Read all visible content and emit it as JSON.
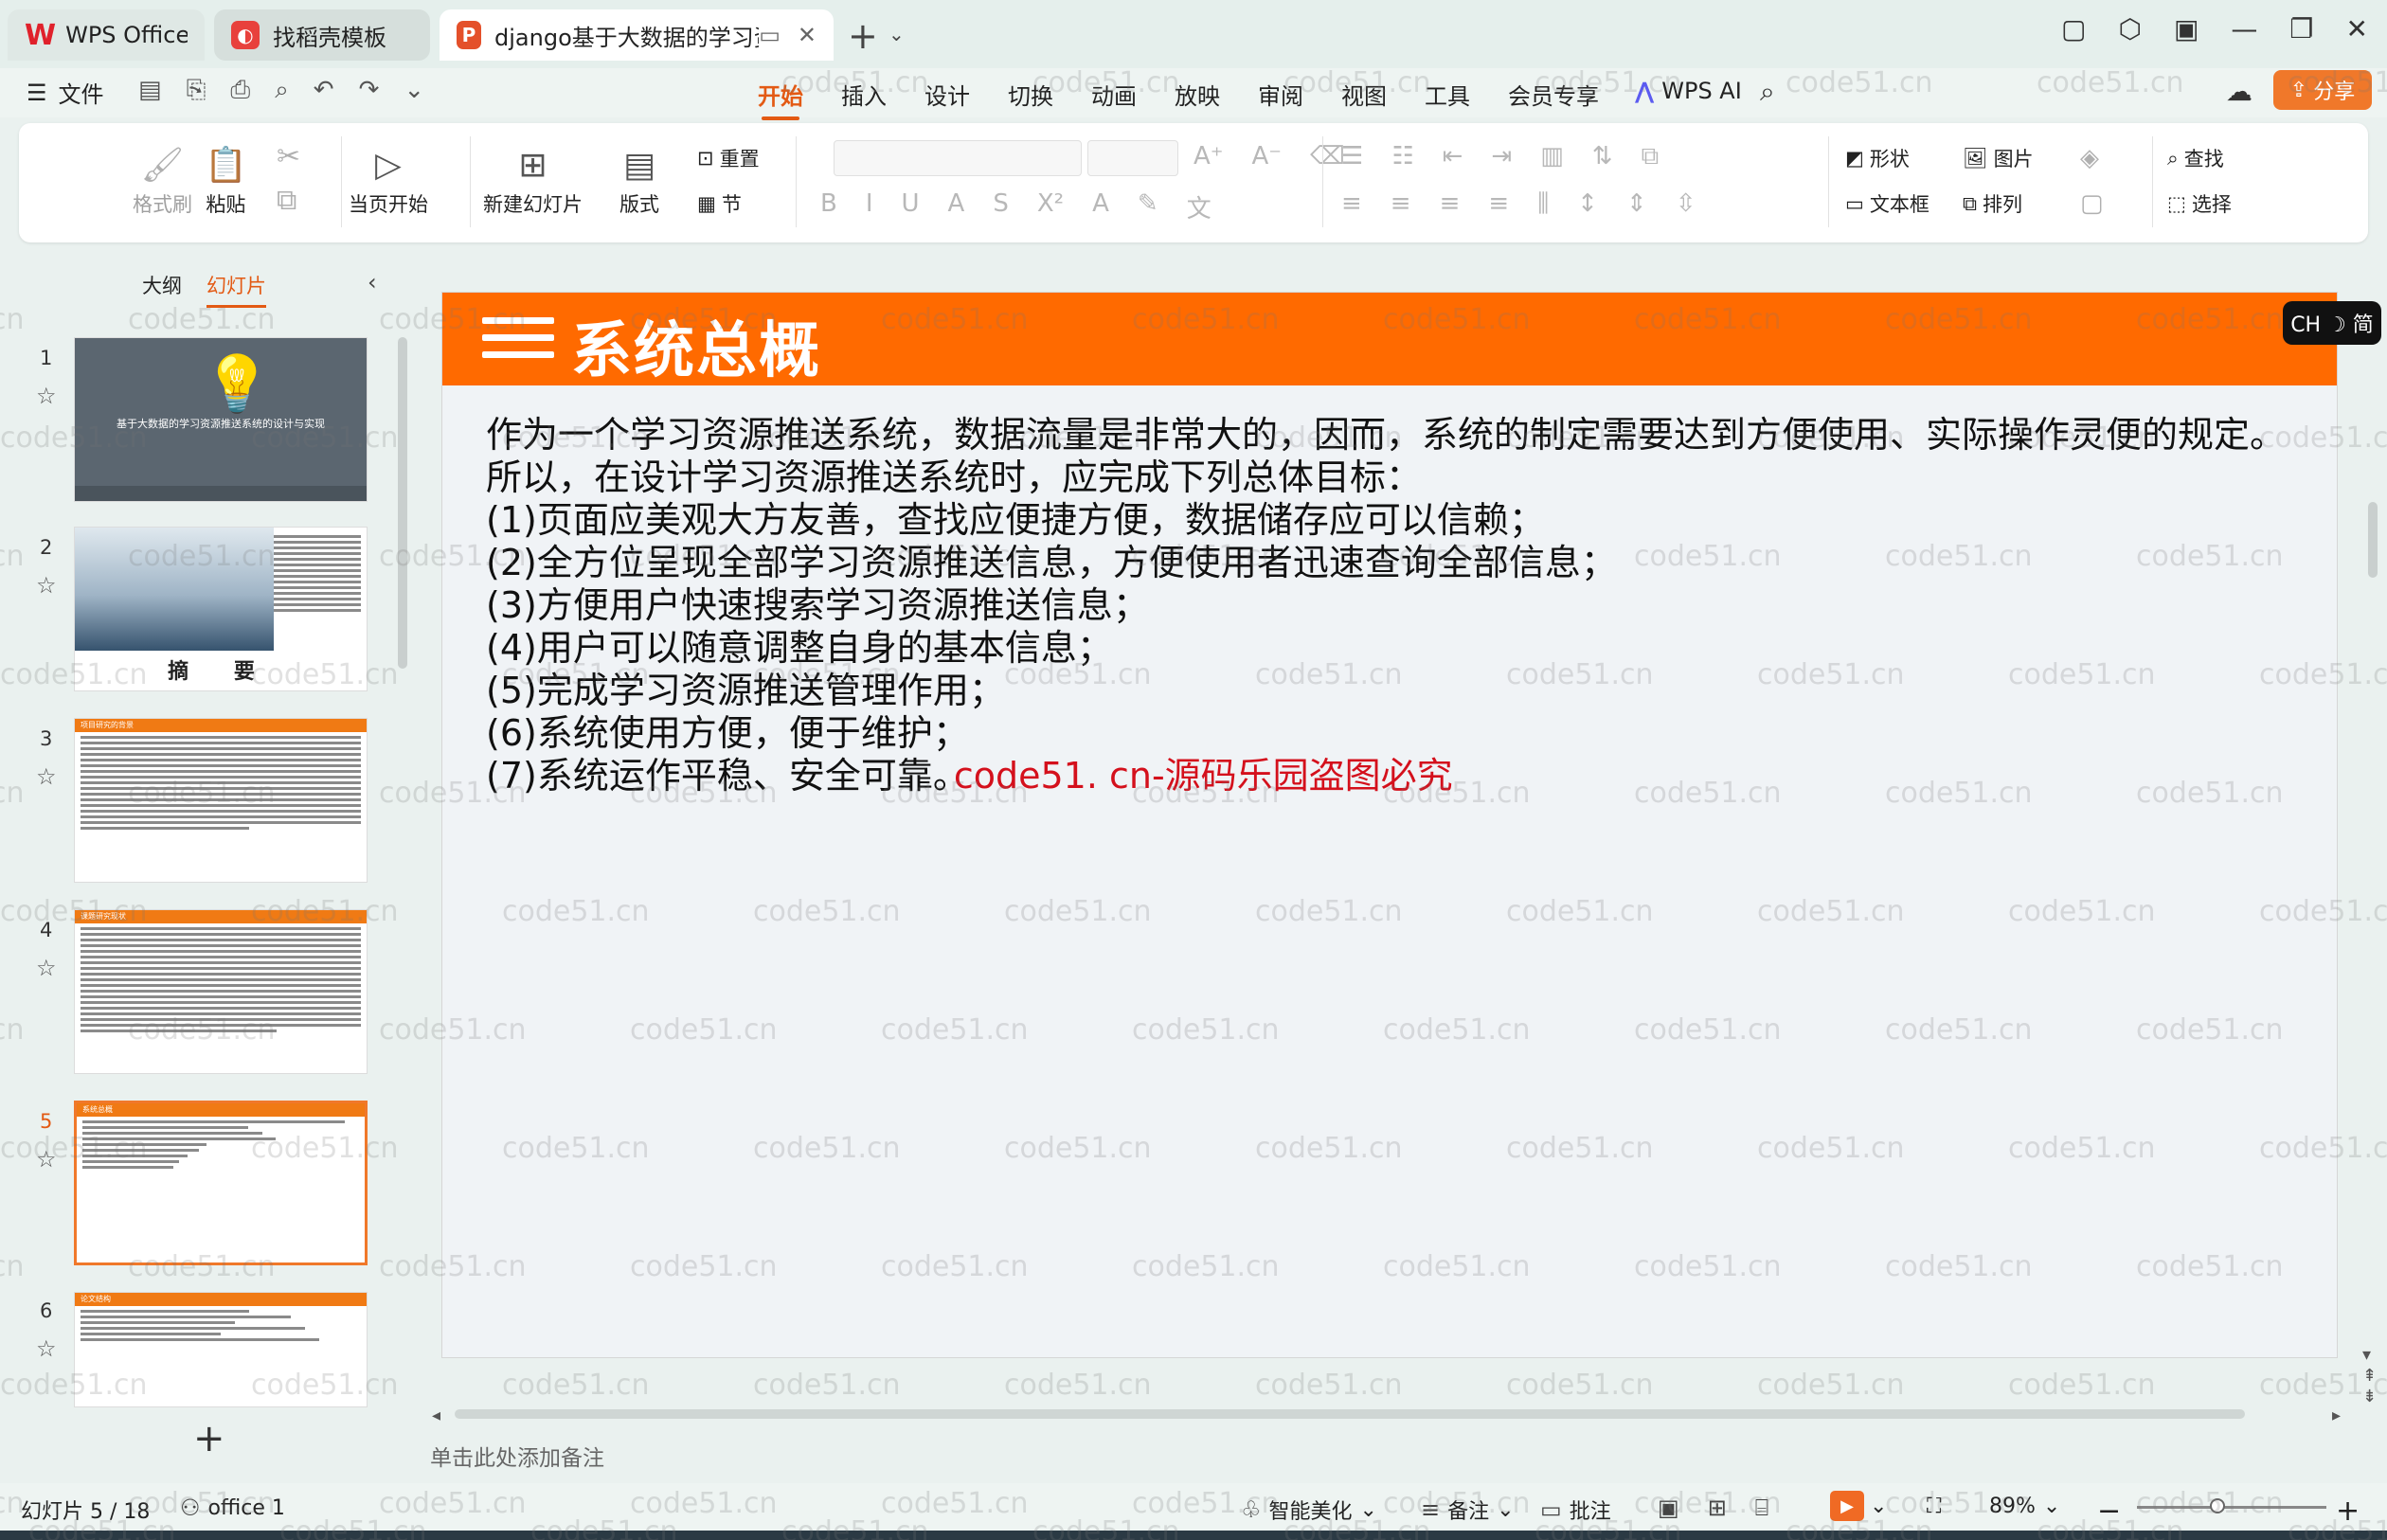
{
  "tabs": [
    {
      "label": "WPS Office"
    },
    {
      "label": "找稻壳模板"
    },
    {
      "label": "django基于大数据的学习资源"
    }
  ],
  "menu": {
    "file": "文件",
    "items": [
      "开始",
      "插入",
      "设计",
      "切换",
      "动画",
      "放映",
      "审阅",
      "视图",
      "工具",
      "会员专享"
    ],
    "wps_ai": "WPS AI",
    "share": "分享"
  },
  "ribbon": {
    "format_painter": "格式刷",
    "paste": "粘贴",
    "play_from_current": "当页开始",
    "new_slide": "新建幻灯片",
    "layout": "版式",
    "reset": "重置",
    "section": "节",
    "shape": "形状",
    "picture": "图片",
    "find": "查找",
    "textbox": "文本框",
    "arrange": "排列",
    "select": "选择"
  },
  "panel": {
    "tab_outline": "大纲",
    "tab_slides": "幻灯片",
    "thumbs": [
      {
        "num": "1",
        "title": "基于大数据的学习资源推送系统的设计与实现"
      },
      {
        "num": "2",
        "title": "摘  要"
      },
      {
        "num": "3",
        "title": "项目研究的背景"
      },
      {
        "num": "4",
        "title": "课题研究现状"
      },
      {
        "num": "5",
        "title": "系统总概"
      },
      {
        "num": "6",
        "title": "论文结构"
      }
    ]
  },
  "slide": {
    "title": "系统总概",
    "lines": [
      "作为一个学习资源推送系统，数据流量是非常大的，因而，系统的制定需要达到方便使用、实际操作灵便的规定。",
      "所以，在设计学习资源推送系统时，应完成下列总体目标：",
      "(1)页面应美观大方友善，查找应便捷方便，数据储存应可以信赖；",
      "(2)全方位呈现全部学习资源推送信息，方便使用者迅速查询全部信息；",
      "(3)方便用户快速搜索学习资源推送信息；",
      "(4)用户可以随意调整自身的基本信息；",
      "(5)完成学习资源推送管理作用；",
      "(6)系统使用方便，便于维护；"
    ],
    "last_line": "(7)系统运作平稳、安全可靠。",
    "overlay": "code51. cn-源码乐园盗图必究"
  },
  "ime": "CH ☽ 简",
  "notes_placeholder": "单击此处添加备注",
  "status": {
    "slide_counter": "幻灯片 5 / 18",
    "theme": "office 1",
    "beautify": "智能美化",
    "notes": "备注",
    "comments": "批注",
    "zoom": "89%"
  },
  "watermark": "code51.cn",
  "colors": {
    "accent": "#e35a14",
    "slide_header": "#ff6a00",
    "overlay_red": "#d4101c"
  }
}
